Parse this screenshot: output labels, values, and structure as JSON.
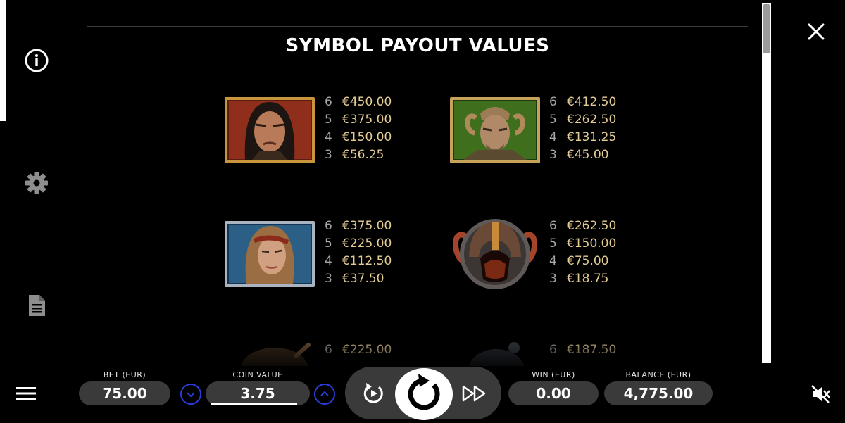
{
  "title": "SYMBOL PAYOUT VALUES",
  "symbols": [
    {
      "name": "dark-haired-warrior",
      "payouts": [
        {
          "count": "6",
          "value": "€450.00"
        },
        {
          "count": "5",
          "value": "€375.00"
        },
        {
          "count": "4",
          "value": "€150.00"
        },
        {
          "count": "3",
          "value": "€56.25"
        }
      ]
    },
    {
      "name": "horned-warrior",
      "payouts": [
        {
          "count": "6",
          "value": "€412.50"
        },
        {
          "count": "5",
          "value": "€262.50"
        },
        {
          "count": "4",
          "value": "€131.25"
        },
        {
          "count": "3",
          "value": "€45.00"
        }
      ]
    },
    {
      "name": "female-warrior",
      "payouts": [
        {
          "count": "6",
          "value": "€375.00"
        },
        {
          "count": "5",
          "value": "€225.00"
        },
        {
          "count": "4",
          "value": "€112.50"
        },
        {
          "count": "3",
          "value": "€37.50"
        }
      ]
    },
    {
      "name": "horned-helmet",
      "payouts": [
        {
          "count": "6",
          "value": "€262.50"
        },
        {
          "count": "5",
          "value": "€150.00"
        },
        {
          "count": "4",
          "value": "€75.00"
        },
        {
          "count": "3",
          "value": "€18.75"
        }
      ]
    },
    {
      "name": "shield-axe",
      "payouts": [
        {
          "count": "6",
          "value": "€225.00"
        }
      ]
    },
    {
      "name": "dark-helmet",
      "payouts": [
        {
          "count": "6",
          "value": "€187.50"
        }
      ]
    }
  ],
  "bottom_bar": {
    "bet_label": "BET (EUR)",
    "bet_value": "75.00",
    "coin_label": "COIN VALUE",
    "coin_value": "3.75",
    "win_label": "WIN (EUR)",
    "win_value": "0.00",
    "balance_label": "BALANCE (EUR)",
    "balance_value": "4,775.00"
  },
  "icons": {
    "info": "info-icon",
    "settings": "gear-icon",
    "paytable": "document-icon",
    "close": "close-icon",
    "menu": "hamburger-menu-icon",
    "sound": "sound-muted-icon",
    "autoplay": "autoplay-icon",
    "spin": "spin-icon",
    "turbo": "fast-forward-icon"
  },
  "colors": {
    "payout_value": "#e4cc95",
    "payout_count": "#a6a6a6",
    "stepper_border": "#2b3bdc",
    "pill_bg": "#3a3a3a"
  }
}
